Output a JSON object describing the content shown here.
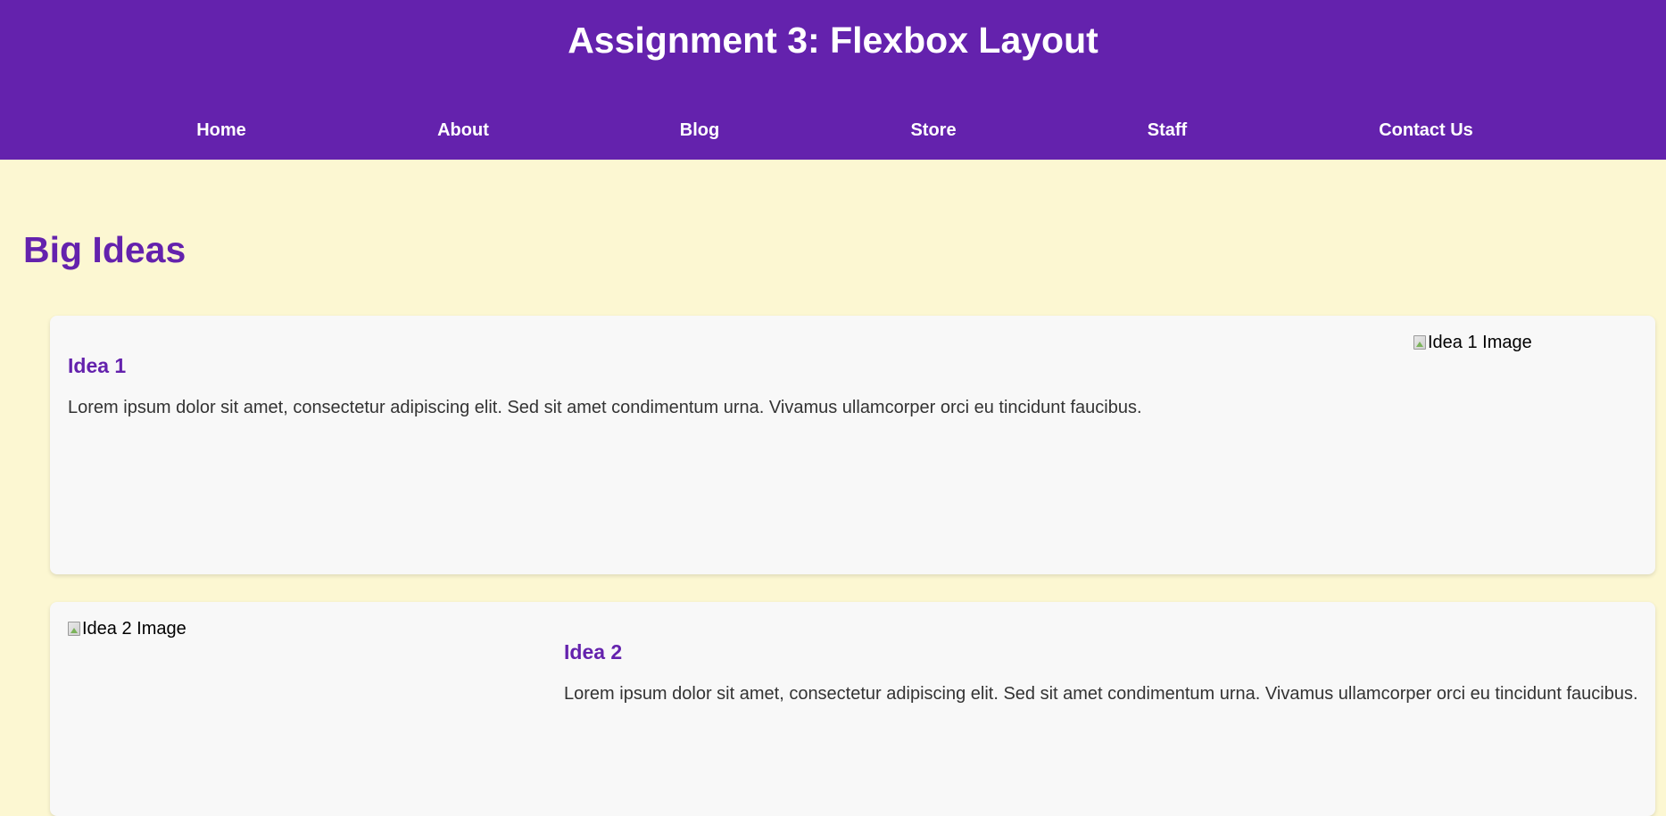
{
  "header": {
    "title": "Assignment 3: Flexbox Layout"
  },
  "nav": {
    "items": [
      {
        "label": "Home"
      },
      {
        "label": "About"
      },
      {
        "label": "Blog"
      },
      {
        "label": "Store"
      },
      {
        "label": "Staff"
      },
      {
        "label": "Contact Us"
      }
    ]
  },
  "main": {
    "section_title": "Big Ideas",
    "ideas": [
      {
        "title": "Idea 1",
        "text": "Lorem ipsum dolor sit amet, consectetur adipiscing elit. Sed sit amet condimentum urna. Vivamus ullamcorper orci eu tincidunt faucibus.",
        "image_alt": "Idea 1 Image"
      },
      {
        "title": "Idea 2",
        "text": "Lorem ipsum dolor sit amet, consectetur adipiscing elit. Sed sit amet condimentum urna. Vivamus ullamcorper orci eu tincidunt faucibus.",
        "image_alt": "Idea 2 Image"
      }
    ]
  },
  "colors": {
    "header_bg": "#6422ad",
    "accent": "#6422ad",
    "page_bg": "#fcf7d2",
    "card_bg": "#f8f8f8"
  }
}
